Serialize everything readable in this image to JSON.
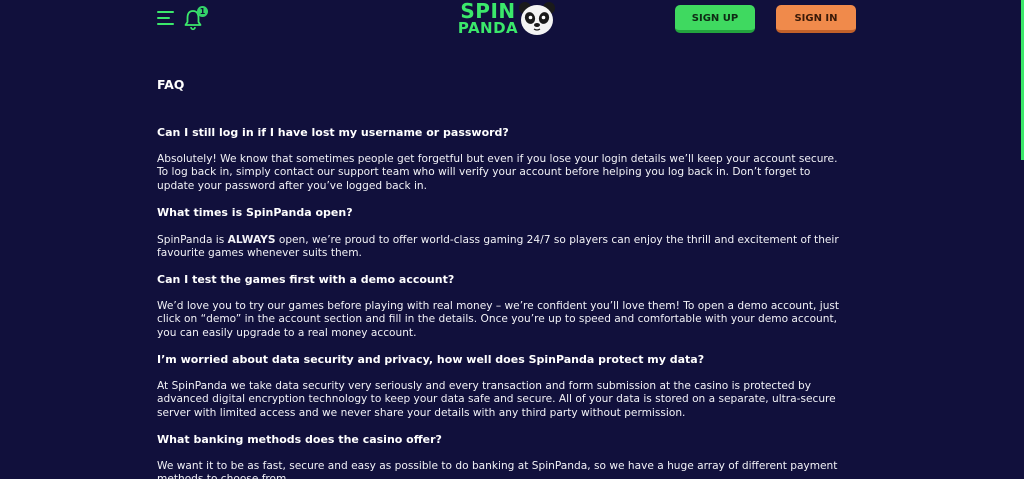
{
  "header": {
    "logo_line1": "SPIN",
    "logo_line2": "PANDA",
    "notification_count": "1",
    "signup_label": "SIGN UP",
    "signin_label": "SIGN IN",
    "brand_green": "#3be86b",
    "signin_orange": "#f08a4b",
    "background": "#11103c"
  },
  "faq": {
    "title": "FAQ",
    "items": [
      {
        "question": "Can I still log in if I have lost my username or password?",
        "answer": "Absolutely! We know that sometimes people get forgetful but even if you lose your login details we’ll keep your account secure. To log back in, simply contact our support team who will verify your account before helping you log back in. Don’t forget to update your password after you’ve logged back in."
      },
      {
        "question": "What times is SpinPanda open?",
        "answer_before": "SpinPanda is ",
        "answer_bold": "ALWAYS",
        "answer_after": " open, we’re proud to offer world-class gaming 24/7 so players can enjoy the thrill and excitement of their favourite games whenever suits them."
      },
      {
        "question": "Can I test the games first with a demo account?",
        "answer": "We’d love you to try our games before playing with real money – we’re confident you’ll love them! To open a demo account, just click on “demo” in the account section and fill in the details. Once you’re up to speed and comfortable with your demo account, you can easily upgrade to a real money account."
      },
      {
        "question": "I’m worried about data security and privacy, how well does SpinPanda protect my data?",
        "answer": "At SpinPanda we take data security very seriously and every transaction and form submission at the casino is protected by advanced digital encryption technology to keep your data safe and secure. All of your data is stored on a separate, ultra-secure server with limited access and we never share your details with any third party without permission."
      },
      {
        "question": "What banking methods does the casino offer?",
        "answer": "We want it to be as fast, secure and easy as possible to do banking at SpinPanda, so we have a huge array of different payment methods to choose from."
      }
    ]
  }
}
